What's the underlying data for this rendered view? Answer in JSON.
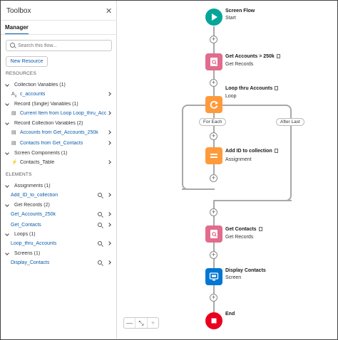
{
  "toolbox": {
    "title": "Toolbox",
    "close_icon": "close-icon",
    "tab": "Manager",
    "search_placeholder": "Search this flow...",
    "new_resource": "New Resource",
    "resources_heading": "RESOURCES",
    "elements_heading": "ELEMENTS",
    "resources": [
      {
        "group": "Collection Variables (1)",
        "items": [
          {
            "label": "c_accounts",
            "icon": "text-variable-icon",
            "icon_text": "A"
          }
        ]
      },
      {
        "group": "Record (Single) Variables (1)",
        "items": [
          {
            "label": "Current Item from Loop Loop_thru_Acc...",
            "icon": "record-icon"
          }
        ]
      },
      {
        "group": "Record Collection Variables (2)",
        "items": [
          {
            "label": "Accounts from Get_Accounts_250k",
            "icon": "record-icon"
          },
          {
            "label": "Contacts from Get_Contacts",
            "icon": "record-icon"
          }
        ]
      },
      {
        "group": "Screen Components (1)",
        "items": [
          {
            "label": "Contacts_Table",
            "icon": "lightning-icon",
            "icon_text": "⚡"
          }
        ]
      }
    ],
    "elements": [
      {
        "group": "Assignments (1)",
        "items": [
          {
            "label": "Add_ID_to_collection"
          }
        ]
      },
      {
        "group": "Get Records (2)",
        "items": [
          {
            "label": "Get_Accounts_250k"
          },
          {
            "label": "Get_Contacts"
          }
        ]
      },
      {
        "group": "Loops (1)",
        "items": [
          {
            "label": "Loop_thru_Accounts"
          }
        ]
      },
      {
        "group": "Screens (1)",
        "items": [
          {
            "label": "Display_Contacts"
          }
        ]
      }
    ]
  },
  "flow": {
    "start": {
      "title": "Screen Flow",
      "sub": "Start",
      "color": "#06a59a"
    },
    "get_accounts": {
      "title": "Get Accounts > 250k",
      "sub": "Get Records",
      "color": "#e16c8d"
    },
    "loop": {
      "title": "Loop thru Accounts",
      "sub": "Loop",
      "color": "#ff9a3c"
    },
    "assign": {
      "title": "Add ID to collection",
      "sub": "Assignment",
      "color": "#ff9a3c"
    },
    "get_contacts": {
      "title": "Get Contacts",
      "sub": "Get Records",
      "color": "#e16c8d"
    },
    "display": {
      "title": "Display Contacts",
      "sub": "Screen",
      "color": "#0176d3"
    },
    "end": {
      "title": "End",
      "color": "#ea001e"
    },
    "for_each": "For Each",
    "after_last": "After Last",
    "plus": "+"
  },
  "zoom": {
    "zoom_out": "—",
    "fit": "⤡",
    "zoom_in": "+"
  }
}
